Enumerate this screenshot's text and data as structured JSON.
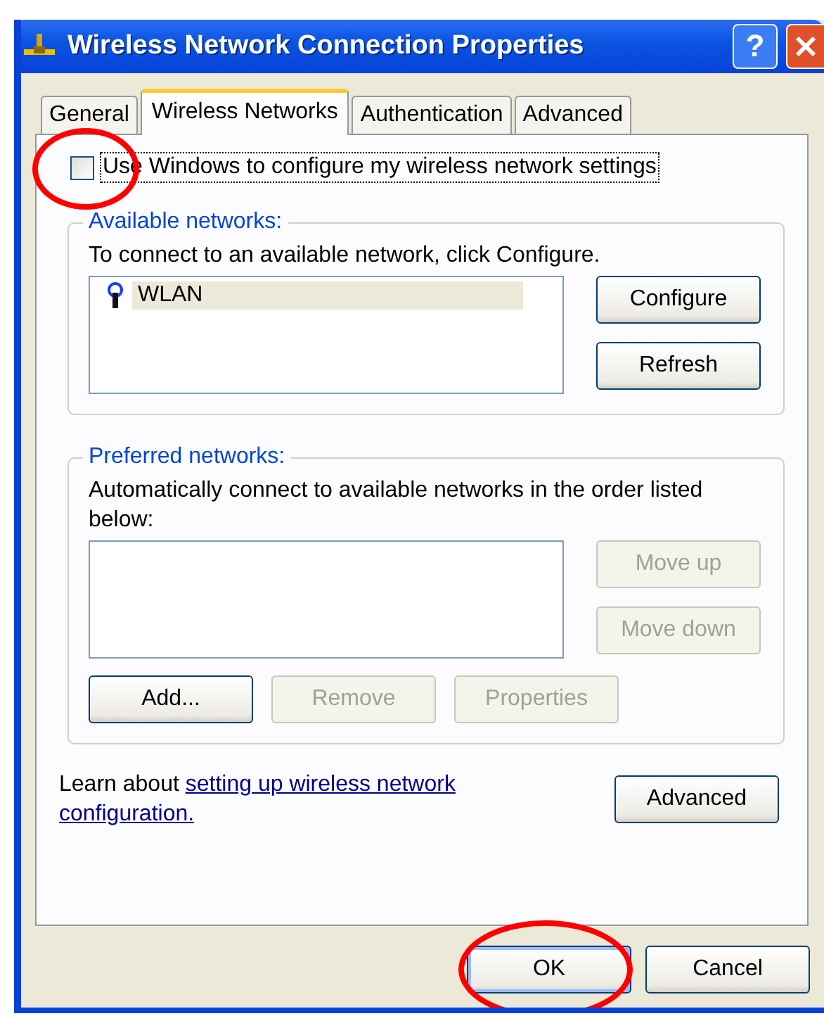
{
  "window": {
    "title": "Wireless Network Connection Properties",
    "help_button": "?"
  },
  "tabs": [
    {
      "label": "General",
      "selected": false
    },
    {
      "label": "Wireless Networks",
      "selected": true
    },
    {
      "label": "Authentication",
      "selected": false
    },
    {
      "label": "Advanced",
      "selected": false
    }
  ],
  "use_windows_checkbox": {
    "label": "Use Windows to configure my wireless network settings",
    "checked": false,
    "focused": true,
    "circled": true
  },
  "available_networks": {
    "title": "Available networks:",
    "description": "To connect to an available network, click Configure.",
    "networks": [
      {
        "name": "WLAN",
        "selected": true
      }
    ],
    "buttons": [
      {
        "label": "Configure",
        "disabled": false
      },
      {
        "label": "Refresh",
        "disabled": false
      }
    ]
  },
  "preferred_networks": {
    "title": "Preferred networks:",
    "description": "Automatically connect to available networks in the order listed below:",
    "move_buttons": [
      {
        "label": "Move up",
        "disabled": true
      },
      {
        "label": "Move down",
        "disabled": true
      }
    ],
    "action_buttons": [
      {
        "label": "Add...",
        "disabled": false
      },
      {
        "label": "Remove",
        "disabled": true
      },
      {
        "label": "Properties",
        "disabled": true
      }
    ]
  },
  "learn_more": {
    "text": "Learn about ",
    "link": "setting up wireless network configuration."
  },
  "advanced_button": {
    "label": "Advanced",
    "disabled": false
  },
  "dialog_buttons": [
    {
      "label": "OK",
      "default": true,
      "circled": true
    },
    {
      "label": "Cancel",
      "default": false,
      "circled": false
    }
  ]
}
